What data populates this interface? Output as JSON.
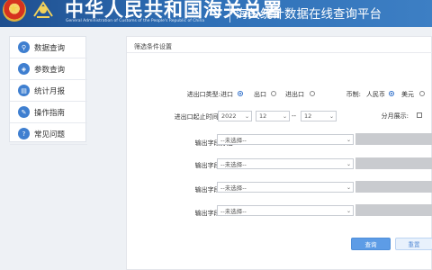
{
  "header": {
    "cn_name": "中华人民共和国海关总署",
    "en_name": "General Administration of Customs of the People's Republic of China",
    "platform_title": "海关统计数据在线查询平台",
    "emblem_icon": "national-emblem-icon",
    "logo_icon": "customs-logo-icon"
  },
  "sidebar": {
    "items": [
      {
        "label": "数据查询",
        "icon": "data-query-icon"
      },
      {
        "label": "参数查询",
        "icon": "parameter-query-icon"
      },
      {
        "label": "统计月报",
        "icon": "monthly-report-icon"
      },
      {
        "label": "操作指南",
        "icon": "guide-icon"
      },
      {
        "label": "常见问题",
        "icon": "faq-icon"
      }
    ]
  },
  "filter": {
    "title": "筛选条件设置",
    "trade_type": {
      "label": "进出口类型:",
      "options": [
        "进口",
        "出口",
        "进出口"
      ],
      "selected": "进口"
    },
    "currency": {
      "label": "币制:",
      "options": [
        "人民币",
        "美元"
      ],
      "selected": "美元"
    },
    "period": {
      "label": "进出口起止时间:",
      "year": "2022",
      "month_start": "12",
      "separator": "--",
      "month_end": "12"
    },
    "monthly_display": {
      "label": "分月展示:",
      "checked": false
    },
    "groups": [
      {
        "label": "输出字段分组:",
        "placeholder": "--未选择--"
      },
      {
        "label": "输出字段分组:",
        "placeholder": "--未选择--"
      },
      {
        "label": "输出字段分组:",
        "placeholder": "--未选择--"
      },
      {
        "label": "输出字段分组:",
        "placeholder": "--未选择--"
      }
    ]
  },
  "actions": {
    "query_label": "查询",
    "reset_label": "重置"
  },
  "colors": {
    "header_blue": "#2e6fb6",
    "accent": "#5d9ce6",
    "nav_icon": "#3f7fd0"
  }
}
